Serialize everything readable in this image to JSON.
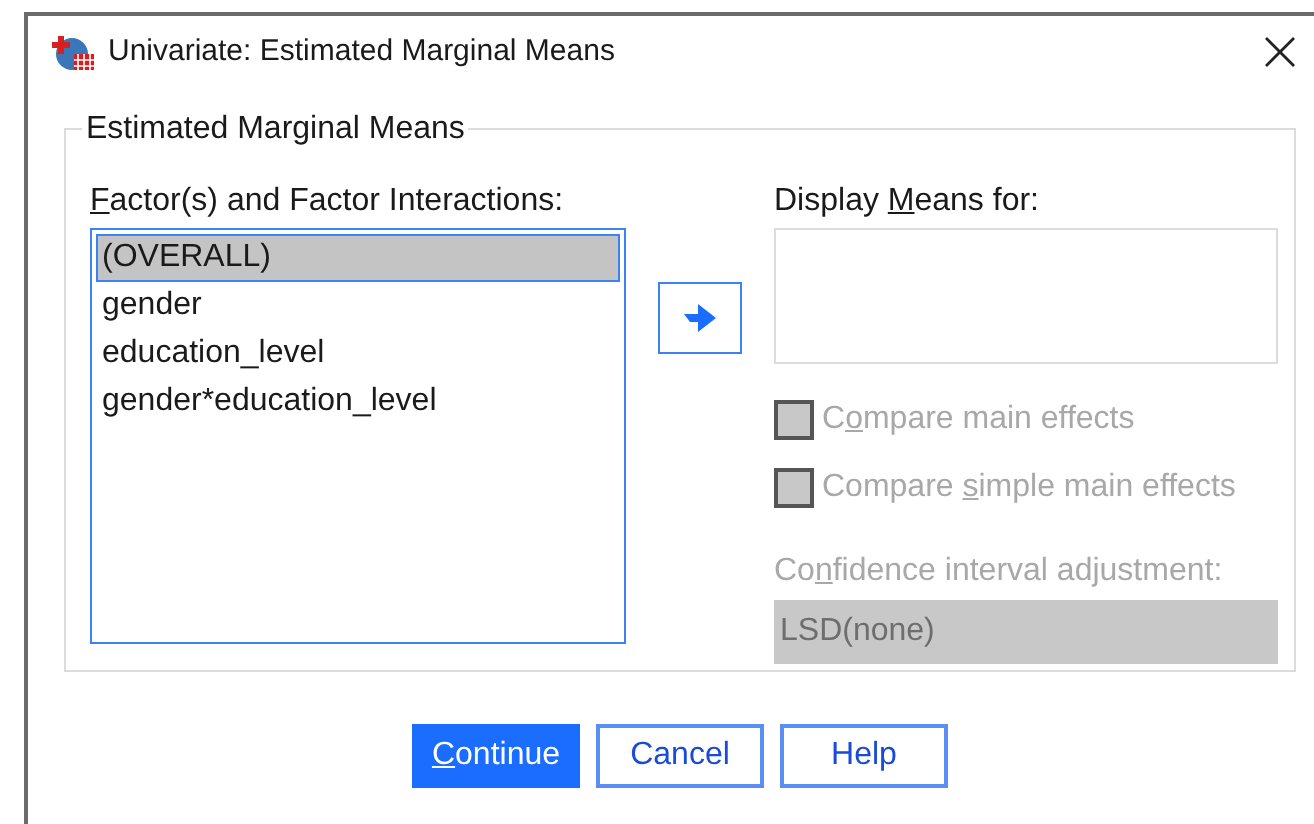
{
  "window": {
    "title": "Univariate: Estimated Marginal Means"
  },
  "group": {
    "title": "Estimated Marginal Means"
  },
  "factors": {
    "label": {
      "key": "F",
      "post": "actor(s) and Factor Interactions:"
    },
    "items": [
      {
        "text": "(OVERALL)",
        "selected": true
      },
      {
        "text": "gender",
        "selected": false
      },
      {
        "text": "education_level",
        "selected": false
      },
      {
        "text": "gender*education_level",
        "selected": false
      }
    ]
  },
  "display_means": {
    "label": {
      "pre": "Display ",
      "key": "M",
      "post": "eans for:"
    }
  },
  "checkboxes": [
    {
      "label": {
        "pre": "C",
        "key": "o",
        "post": "mpare main effects"
      },
      "checked": false,
      "disabled": true
    },
    {
      "label": {
        "pre": "Compare ",
        "key": "s",
        "post": "imple main effects"
      },
      "checked": false,
      "disabled": true
    }
  ],
  "ci_adjustment": {
    "label": {
      "pre": "Co",
      "key": "n",
      "post": "fidence interval adjustment:"
    },
    "value": "LSD(none)",
    "disabled": true
  },
  "buttons": [
    {
      "label": {
        "key": "C",
        "post": "ontinue"
      },
      "default": true
    },
    {
      "label": {
        "pre": "Cancel"
      },
      "default": false
    },
    {
      "label": {
        "pre": "Help"
      },
      "default": false
    }
  ]
}
